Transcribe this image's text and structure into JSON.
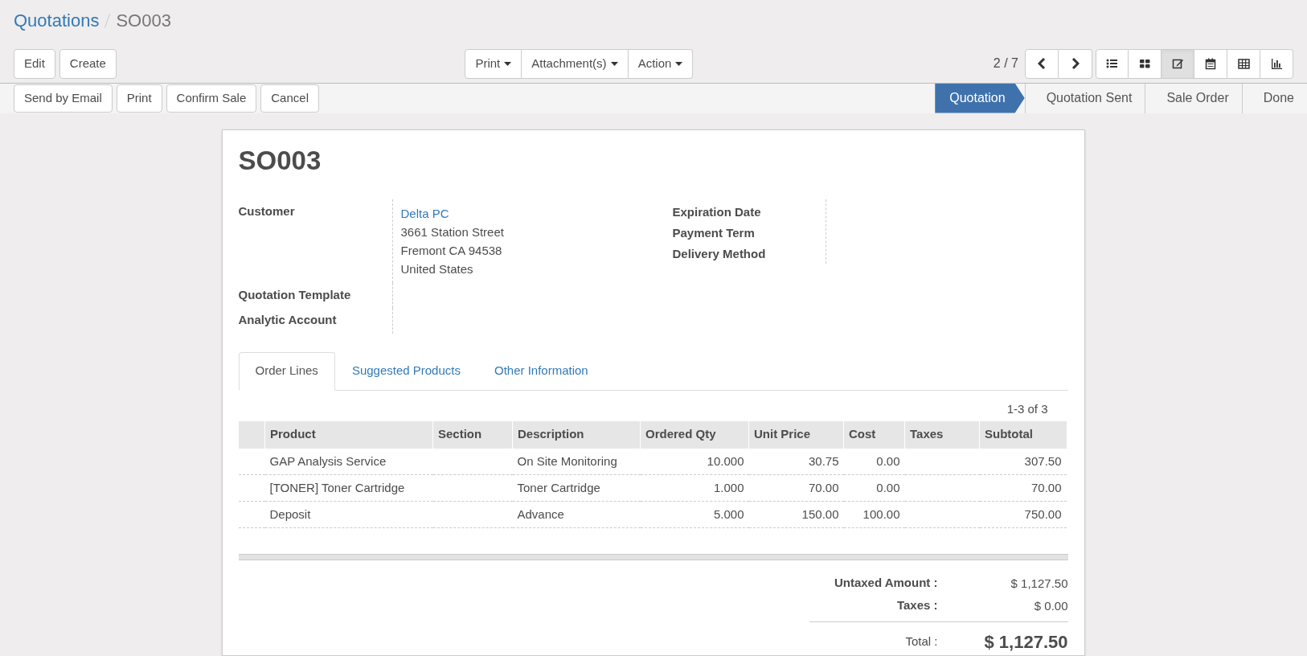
{
  "breadcrumb": [
    {
      "label": "Quotations",
      "kind": "link"
    },
    {
      "label": "SO003",
      "kind": "current"
    }
  ],
  "main_buttons": [
    "Edit",
    "Create"
  ],
  "dropdowns": [
    "Print",
    "Attachment(s)",
    "Action"
  ],
  "pager": "2 / 7",
  "views": [
    {
      "kind": "list",
      "selected": false
    },
    {
      "kind": "kanban",
      "selected": false
    },
    {
      "kind": "form",
      "selected": true
    },
    {
      "kind": "calendar",
      "selected": false
    },
    {
      "kind": "pivot",
      "selected": false
    },
    {
      "kind": "graph",
      "selected": false
    }
  ],
  "action_buttons": [
    "Send by Email",
    "Print",
    "Confirm Sale",
    "Cancel"
  ],
  "stages": [
    {
      "label": "Quotation",
      "selected": true
    },
    {
      "label": "Quotation Sent",
      "selected": false
    },
    {
      "label": "Sale Order",
      "selected": false
    },
    {
      "label": "Done",
      "selected": false
    }
  ],
  "sheet": {
    "title": "SO003",
    "left_fields": [
      {
        "label": "Customer",
        "link": "Delta PC",
        "lines": [
          "3661 Station Street",
          "Fremont CA 94538",
          "United States"
        ]
      },
      {
        "label": "Quotation Template"
      },
      {
        "label": "Analytic Account"
      }
    ],
    "right_fields": [
      {
        "label": "Expiration Date"
      },
      {
        "label": "Payment Term"
      },
      {
        "label": "Delivery Method"
      }
    ],
    "tabs": [
      {
        "label": "Order Lines",
        "selected": true
      },
      {
        "label": "Suggested Products",
        "selected": false
      },
      {
        "label": "Other Information",
        "selected": false
      }
    ],
    "list_pager": "1-3 of 3",
    "columns": [
      {
        "label": "Product",
        "kind": "text"
      },
      {
        "label": "Section",
        "kind": "text"
      },
      {
        "label": "Description",
        "kind": "text"
      },
      {
        "label": "Ordered Qty",
        "kind": "number"
      },
      {
        "label": "Unit Price",
        "kind": "number"
      },
      {
        "label": "Cost",
        "kind": "number"
      },
      {
        "label": "Taxes",
        "kind": "text"
      },
      {
        "label": "Subtotal",
        "kind": "number"
      }
    ],
    "rows": [
      [
        "GAP Analysis Service",
        "",
        "On Site Monitoring",
        "10.000",
        "30.75",
        "0.00",
        "",
        "307.50"
      ],
      [
        "[TONER] Toner Cartridge",
        "",
        "Toner Cartridge",
        "1.000",
        "70.00",
        "0.00",
        "",
        "70.00"
      ],
      [
        "Deposit",
        "",
        "Advance",
        "5.000",
        "150.00",
        "100.00",
        "",
        "750.00"
      ]
    ],
    "totals": [
      {
        "label": "Untaxed Amount :",
        "value": "$ 1,127.50",
        "kind": "sub"
      },
      {
        "label": "Taxes :",
        "value": "$ 0.00",
        "kind": "sub"
      },
      {
        "label": "Total :",
        "value": "$ 1,127.50",
        "kind": "grand"
      }
    ]
  }
}
